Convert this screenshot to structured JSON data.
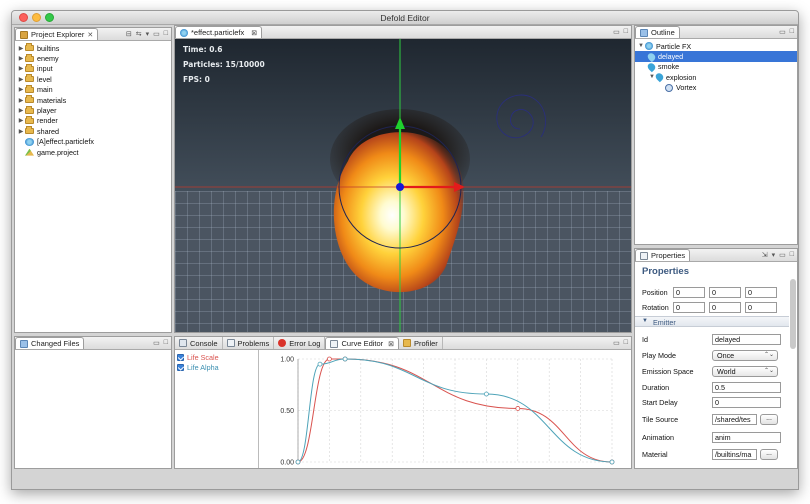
{
  "app": {
    "title": "Defold Editor"
  },
  "project_explorer": {
    "tab_label": "Project Explorer",
    "items": [
      {
        "label": "builtins",
        "type": "folder"
      },
      {
        "label": "enemy",
        "type": "folder"
      },
      {
        "label": "input",
        "type": "folder"
      },
      {
        "label": "level",
        "type": "folder"
      },
      {
        "label": "main",
        "type": "folder"
      },
      {
        "label": "materials",
        "type": "folder"
      },
      {
        "label": "player",
        "type": "folder"
      },
      {
        "label": "render",
        "type": "folder"
      },
      {
        "label": "shared",
        "type": "folder"
      },
      {
        "label": "[A]effect.particlefx",
        "type": "file"
      },
      {
        "label": "game.project",
        "type": "file"
      }
    ]
  },
  "changed_files": {
    "tab_label": "Changed Files"
  },
  "editor": {
    "tab_label": "*effect.particlefx",
    "time_label": "Time: 0.6",
    "particles_label": "Particles: 15/10000",
    "fps_label": "FPS: 0"
  },
  "bottom_tabs": {
    "console": "Console",
    "problems": "Problems",
    "error_log": "Error Log",
    "curve_editor": "Curve Editor",
    "profiler": "Profiler"
  },
  "curve_editor": {
    "curves": [
      {
        "label": "Life Scale",
        "color": "#d9534f",
        "checked": true
      },
      {
        "label": "Life Alpha",
        "color": "#4da3b8",
        "checked": true
      }
    ],
    "y_ticks": [
      "1.00",
      "0.50",
      "0.00"
    ]
  },
  "chart_data": {
    "type": "line",
    "ylim": [
      0,
      1
    ],
    "xlim": [
      0,
      1
    ],
    "y_ticks": [
      "1.00",
      "0.50",
      "0.00"
    ],
    "series": [
      {
        "name": "Life Scale",
        "color": "#d9534f",
        "x": [
          0.0,
          0.1,
          0.15,
          0.7,
          1.0
        ],
        "y": [
          0.0,
          1.0,
          1.0,
          0.52,
          0.0
        ]
      },
      {
        "name": "Life Alpha",
        "color": "#4da3b8",
        "x": [
          0.0,
          0.07,
          0.15,
          0.6,
          1.0
        ],
        "y": [
          0.0,
          0.95,
          1.0,
          0.66,
          0.0
        ]
      }
    ]
  },
  "outline": {
    "tab_label": "Outline",
    "items": [
      {
        "label": "Particle FX"
      },
      {
        "label": "delayed"
      },
      {
        "label": "smoke"
      },
      {
        "label": "explosion"
      },
      {
        "label": "Vortex"
      }
    ]
  },
  "properties": {
    "tab_label": "Properties",
    "heading": "Properties",
    "position_label": "Position",
    "position": [
      "0",
      "0",
      "0"
    ],
    "rotation_label": "Rotation",
    "rotation": [
      "0",
      "0",
      "0"
    ],
    "emitter_section": "Emitter",
    "fields": {
      "id_label": "Id",
      "id": "delayed",
      "play_mode_label": "Play Mode",
      "play_mode": "Once",
      "emission_space_label": "Emission Space",
      "emission_space": "World",
      "duration_label": "Duration",
      "duration": "0.5",
      "start_delay_label": "Start Delay",
      "start_delay": "0",
      "tile_source_label": "Tile Source",
      "tile_source": "/shared/tes",
      "animation_label": "Animation",
      "animation": "anim",
      "material_label": "Material",
      "material": "/builtins/ma",
      "browse_label": "..."
    }
  }
}
